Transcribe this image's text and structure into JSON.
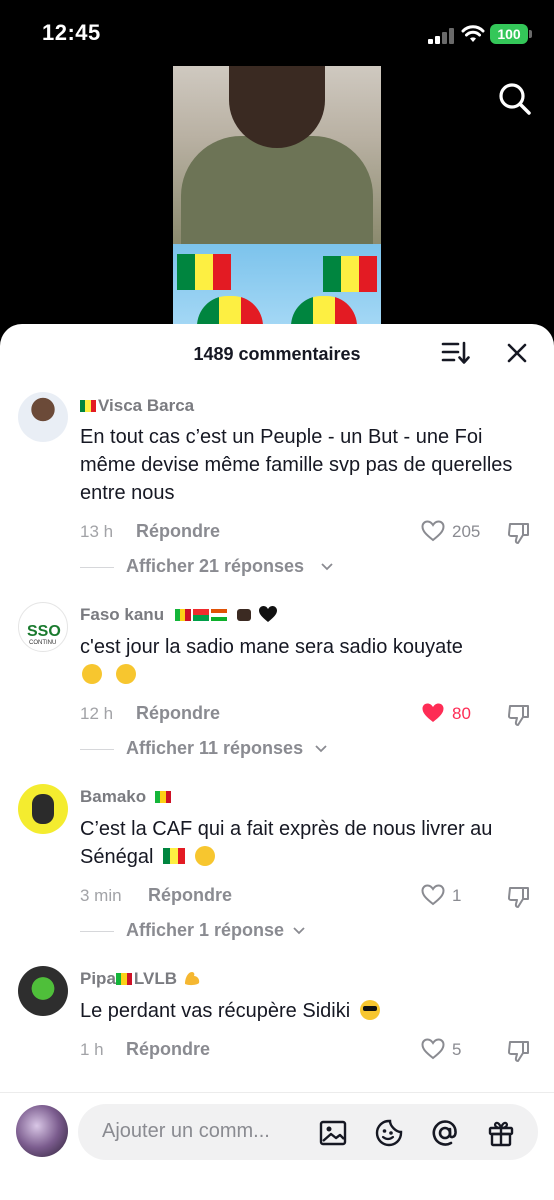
{
  "status_bar": {
    "time": "12:45",
    "battery": "100"
  },
  "sheet": {
    "title": "1489 commentaires"
  },
  "comments": [
    {
      "username": "Visca Barca",
      "text": "En tout cas c’est un Peuple - un But - une Foi même devise même famille svp pas de querelles entre nous",
      "time": "13 h",
      "reply_label": "Répondre",
      "likes": "205",
      "liked": false,
      "view_replies": "Afficher 21 réponses"
    },
    {
      "username": "Faso kanu",
      "text": "c'est jour la sadio mane sera sadio kouyate",
      "time": "12 h",
      "reply_label": "Répondre",
      "likes": "80",
      "liked": true,
      "view_replies": "Afficher 11 réponses"
    },
    {
      "username": "Bamako",
      "text": "C’est la CAF qui a fait exprès de nous livrer au Sénégal",
      "time": "3 min",
      "reply_label": "Répondre",
      "likes": "1",
      "liked": false,
      "view_replies": "Afficher 1 réponse"
    },
    {
      "username": "Pipa",
      "username_suffix": "LVLB",
      "text": "Le perdant vas récupère Sidiki",
      "time": "1 h",
      "reply_label": "Répondre",
      "likes": "5",
      "liked": false
    }
  ],
  "video_avatar_text": {
    "badge": "SSO",
    "badge_sub": "CONTINU"
  },
  "input": {
    "placeholder": "Ajouter un comm..."
  },
  "colors": {
    "liked_red": "#fe2c55",
    "battery_green": "#34c759"
  },
  "icons": [
    "search-icon",
    "sort-icon",
    "close-icon",
    "heart-icon",
    "dislike-icon",
    "chevron-down-icon",
    "image-icon",
    "sticker-icon",
    "mention-icon",
    "gift-icon"
  ]
}
